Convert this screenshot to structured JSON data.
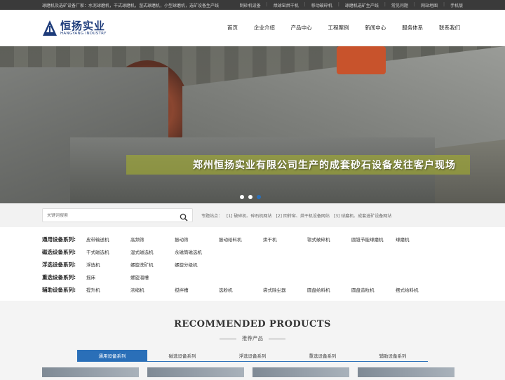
{
  "topbar": {
    "left": "球磨机及选矿设备厂家：水泥球磨机，干式球磨机，湿式球磨机，小型球磨机，选矿设备生产线",
    "links": [
      "制砂机设备",
      "烘球窑烘干机",
      "移动破碎机",
      "球磨机选矿生产线",
      "常见问题",
      "网站地图",
      "手机版"
    ]
  },
  "header": {
    "logo_cn": "恒扬实业",
    "logo_en": "HANGYANG INDUSTRY",
    "nav": [
      "首页",
      "企业介绍",
      "产品中心",
      "工程案例",
      "新闻中心",
      "服务体系",
      "联系我们"
    ]
  },
  "banner": {
    "caption": "郑州恒扬实业有限公司生产的成套砂石设备发往客户现场",
    "slide_count": 3,
    "active_slide": 3
  },
  "search": {
    "placeholder": "关键词搜索",
    "hot_label": "专题站点：",
    "hot_links": [
      "[1] 破碎机、碎石机网站",
      "[2] 回转窑、烘干机设备网站",
      "[3] 球磨机、成套选矿设备网站"
    ]
  },
  "categories": [
    {
      "title": "通用设备系列:",
      "items": [
        "皮带输送机",
        "高频筛",
        "振动筛",
        "振动给料机",
        "烘干机",
        "颚式破碎机",
        "圆锥节能球磨机",
        "球磨机"
      ]
    },
    {
      "title": "磁选设备系列:",
      "items": [
        "干式磁选机",
        "湿式磁选机",
        "永磁筒磁选机"
      ]
    },
    {
      "title": "浮选设备系列:",
      "items": [
        "浮选机",
        "螺旋洗矿机",
        "螺旋分级机"
      ]
    },
    {
      "title": "重选设备系列:",
      "items": [
        "摇床",
        "螺旋溜槽"
      ]
    },
    {
      "title": "辅助设备系列:",
      "items": [
        "提升机",
        "浓缩机",
        "搅拌槽",
        "选粉机",
        "袋式除尘器",
        "圆盘给料机",
        "圆盘造粒机",
        "摆式给料机"
      ]
    }
  ],
  "recommended": {
    "title": "RECOMMENDED PRODUCTS",
    "subtitle": "推荐产品",
    "tabs": [
      "通用设备系列",
      "磁选设备系列",
      "浮选设备系列",
      "重选设备系列",
      "辅助设备系列"
    ],
    "active_tab": 0
  },
  "colors": {
    "accent": "#2a6fb8",
    "logo": "#1d3b7a",
    "topbar": "#3a3a3a"
  }
}
